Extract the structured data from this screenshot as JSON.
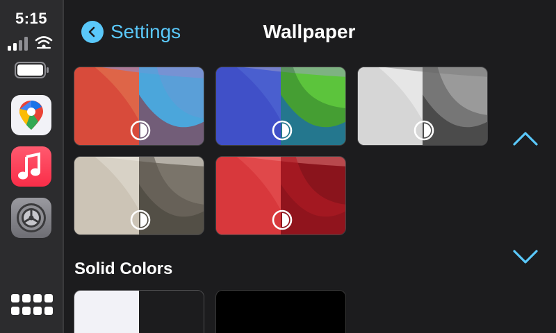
{
  "status": {
    "time": "5:15"
  },
  "dock": {
    "apps": [
      "maps-icon",
      "music-icon",
      "settings-icon"
    ],
    "grid": "app-grid-icon"
  },
  "header": {
    "back_label": "Settings",
    "title": "Wallpaper"
  },
  "wallpapers": [
    {
      "name": "red-blue",
      "light": "#e06a4a",
      "dark": "#a01820"
    },
    {
      "name": "blue-green",
      "light": "#4a62d0",
      "dark": "#3aaa3a"
    },
    {
      "name": "white",
      "light": "#e8e8e8",
      "dark": "#3a3a3a"
    },
    {
      "name": "gray",
      "light": "#d8d2c6",
      "dark": "#4a4640"
    },
    {
      "name": "red",
      "light": "#e24a4a",
      "dark": "#5a0c12"
    }
  ],
  "solid_colors": {
    "heading": "Solid Colors",
    "items": [
      {
        "name": "white-black",
        "light": "#f2f2f7",
        "dark": "#1c1c1e"
      },
      {
        "name": "black",
        "light": "#000000",
        "dark": "#000000"
      }
    ]
  },
  "colors": {
    "accent": "#5ac8fa",
    "background": "#1c1c1e",
    "sidebar": "#2c2c2e"
  }
}
